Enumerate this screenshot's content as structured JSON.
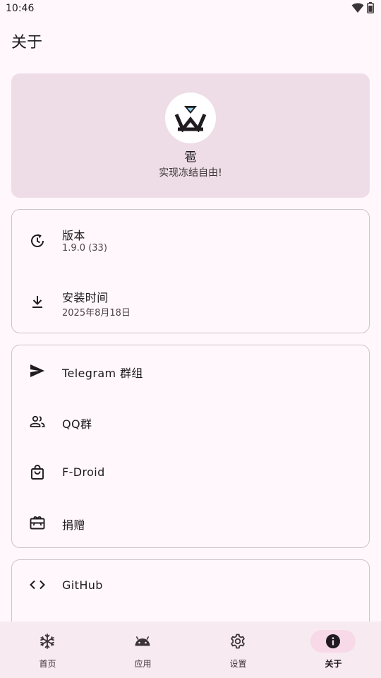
{
  "status_bar": {
    "time": "10:46",
    "icons": [
      "wifi-icon",
      "battery-icon"
    ]
  },
  "page": {
    "title": "关于"
  },
  "hero": {
    "app_name": "雹",
    "tagline": "实现冻结自由!",
    "logo_icon": "hail-logo-icon",
    "logo_accent_color": "#8ecfe8"
  },
  "info_card": {
    "items": [
      {
        "icon": "update-history-icon",
        "label": "版本",
        "value": "1.9.0 (33)"
      },
      {
        "icon": "download-icon",
        "label": "安装时间",
        "value": "2025年8月18日"
      }
    ]
  },
  "links_card": {
    "items": [
      {
        "icon": "send-icon",
        "label": "Telegram 群组"
      },
      {
        "icon": "group-icon",
        "label": "QQ群"
      },
      {
        "icon": "shopping-bag-icon",
        "label": "F-Droid"
      },
      {
        "icon": "gift-card-icon",
        "label": "捐赠"
      }
    ]
  },
  "source_card": {
    "items": [
      {
        "icon": "code-icon",
        "label": "GitHub"
      }
    ]
  },
  "bottom_nav": {
    "items": [
      {
        "icon": "snowflake-icon",
        "label": "首页",
        "active": false
      },
      {
        "icon": "android-icon",
        "label": "应用",
        "active": false
      },
      {
        "icon": "gear-icon",
        "label": "设置",
        "active": false
      },
      {
        "icon": "info-icon",
        "label": "关于",
        "active": true
      }
    ]
  },
  "colors": {
    "background": "#fff7fb",
    "hero_background": "#eedde6",
    "card_border": "#cdc3c8",
    "nav_background": "#f8eaf1",
    "nav_active_pill": "#f7d9e8"
  }
}
